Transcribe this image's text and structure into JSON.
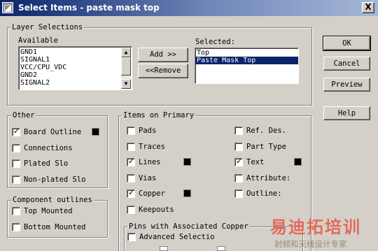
{
  "window": {
    "title": "Select Items - paste mask top",
    "icon": "app-icon",
    "close_label": "X"
  },
  "layer_selections": {
    "legend": "Layer Selections",
    "available_label": "Available",
    "available_items": [
      "GND1",
      "SIGNAL1",
      "VCC/CPU_VDC",
      "GND2",
      "SIGNAL2"
    ],
    "add_label": "Add >>",
    "remove_label": "<<Remove",
    "selected_label": "Selected:",
    "selected_items": [
      "Top",
      "Paste Mask Top"
    ],
    "selected_index": 1
  },
  "buttons": {
    "ok": "OK",
    "cancel": "Cancel",
    "preview": "Preview",
    "help": "Help"
  },
  "other": {
    "legend": "Other",
    "items": [
      {
        "label": "Board Outline",
        "checked": true,
        "color": "#000000"
      },
      {
        "label": "Connections",
        "checked": false
      },
      {
        "label": "Plated Slo",
        "checked": false
      },
      {
        "label": "Non-plated Slo",
        "checked": false
      }
    ]
  },
  "component_outlines": {
    "legend": "Component outlines",
    "items": [
      {
        "label": "Top Mounted",
        "checked": false
      },
      {
        "label": "Bottom Mounted",
        "checked": false
      }
    ]
  },
  "items_on_primary": {
    "legend": "Items on Primary",
    "left": [
      {
        "label": "Pads",
        "checked": false
      },
      {
        "label": "Traces",
        "checked": false
      },
      {
        "label": "Lines",
        "checked": true,
        "color": "#000000"
      },
      {
        "label": "Vias",
        "checked": false
      },
      {
        "label": "Copper",
        "checked": true,
        "color": "#000000"
      },
      {
        "label": "Keepouts",
        "checked": false
      }
    ],
    "right": [
      {
        "label": "Ref. Des.",
        "checked": false
      },
      {
        "label": "Part Type",
        "checked": false
      },
      {
        "label": "Text",
        "checked": true,
        "color": "#000000"
      },
      {
        "label": "Attribute:",
        "checked": false
      },
      {
        "label": "Outline:",
        "checked": false
      }
    ]
  },
  "pins_copper": {
    "legend": "Pins with Associated Copper",
    "advanced_label": "Advanced Selectio",
    "advanced_checked": false
  },
  "watermark": {
    "line1": "易迪拓培训",
    "line2": "射频和天线设计专家"
  }
}
